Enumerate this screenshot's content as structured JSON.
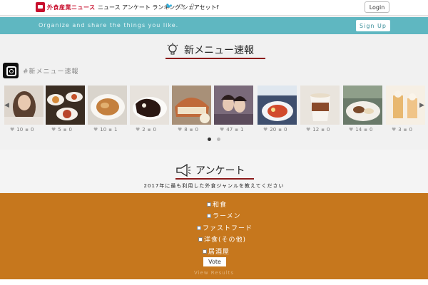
{
  "header": {
    "logo_text": "外食産業ニュース",
    "nav_text": "ニュース アンケート ランキング シェアセットf",
    "login_label": "Login"
  },
  "banner": {
    "tagline": "Organize and share the things you like.",
    "signup_label": "Sign Up"
  },
  "news": {
    "title": "新メニュー速報",
    "hashtag": "#新メニュー速報",
    "posts": [
      {
        "likes": "10",
        "comments": "0"
      },
      {
        "likes": "5",
        "comments": "0"
      },
      {
        "likes": "10",
        "comments": "1"
      },
      {
        "likes": "2",
        "comments": "0"
      },
      {
        "likes": "8",
        "comments": "0"
      },
      {
        "likes": "47",
        "comments": "1"
      },
      {
        "likes": "20",
        "comments": "0"
      },
      {
        "likes": "12",
        "comments": "0"
      },
      {
        "likes": "14",
        "comments": "0"
      },
      {
        "likes": "3",
        "comments": "0"
      }
    ]
  },
  "survey": {
    "title": "アンケート",
    "question": "2017年に最も利用した外食ジャンルを教えてください",
    "options": [
      "和食",
      "ラーメン",
      "ファストフード",
      "洋食(その他)",
      "居酒屋"
    ],
    "vote_label": "Vote",
    "results_label": "View Results"
  },
  "colors": {
    "banner": "#5fb7c1",
    "poll_bg": "#c6771d",
    "accent": "#8b1a1a",
    "logo": "#c8102e"
  },
  "icons": [
    "logo-icon",
    "twitter-icon",
    "rss-icon",
    "search-icon",
    "bulb-icon",
    "instagram-icon",
    "megaphone-icon",
    "heart-icon",
    "comment-icon",
    "arrow-left-icon",
    "arrow-right-icon"
  ]
}
